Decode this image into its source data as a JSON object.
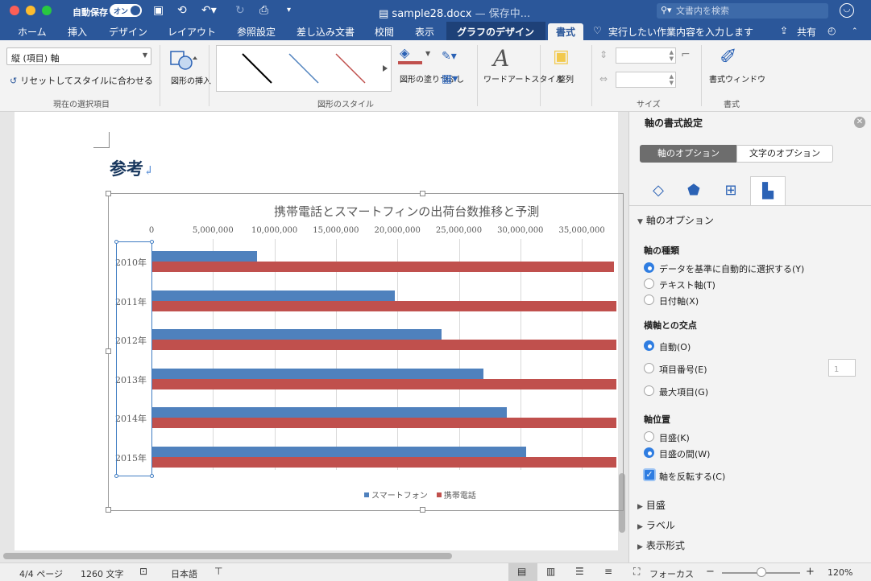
{
  "titlebar": {
    "autosave_label": "自動保存",
    "autosave_state": "オン",
    "file_name": "sample28.docx",
    "save_status": "— 保存中...",
    "search_placeholder": "文書内を検索"
  },
  "tabs": [
    "ホーム",
    "挿入",
    "デザイン",
    "レイアウト",
    "参照設定",
    "差し込み文書",
    "校閲",
    "表示",
    "グラフのデザイン",
    "書式"
  ],
  "active_tab": "書式",
  "tell_me": "実行したい作業内容を入力します",
  "share_label": "共有",
  "ribbon": {
    "selection_value": "縦 (項目) 軸",
    "reset_label": "リセットしてスタイルに合わせる",
    "group_current_selection": "現在の選択項目",
    "insert_shape": "図形の挿入",
    "group_shape_styles": "図形のスタイル",
    "shape_fill": "図形の塗りつぶし",
    "wordart": "ワードアートスタイル",
    "arrange": "整列",
    "group_size": "サイズ",
    "format_pane": "書式ウィンドウ",
    "group_format": "書式"
  },
  "document": {
    "heading": "参考",
    "chart": {
      "legend": [
        "スマートフォン",
        "携帯電話"
      ]
    }
  },
  "chart_data": {
    "type": "bar",
    "orientation": "horizontal",
    "title": "携帯電話とスマートフィンの出荷台数推移と予測",
    "categories": [
      "2010年",
      "2011年",
      "2012年",
      "2013年",
      "2014年",
      "2015年"
    ],
    "x_ticks": [
      "0",
      "5,000,000",
      "10,000,000",
      "15,000,000",
      "20,000,000",
      "25,000,000",
      "30,000,000",
      "35,000,000"
    ],
    "xlim": [
      0,
      40000000
    ],
    "y_reversed": true,
    "x_axis_position": "top",
    "grid": true,
    "legend_position": "bottom",
    "series": [
      {
        "name": "スマートフォン",
        "color": "#4f81bd",
        "values": [
          8600000,
          19800000,
          23600000,
          27000000,
          28900000,
          30500000
        ]
      },
      {
        "name": "携帯電話",
        "color": "#c0504d",
        "values": [
          37600000,
          40000000,
          40000000,
          40000000,
          40000000,
          40000000
        ]
      }
    ]
  },
  "pane": {
    "title": "軸の書式設定",
    "tab_axis": "軸のオプション",
    "tab_text": "文字のオプション",
    "section_axis_options": "軸のオプション",
    "axis_type_title": "軸の種類",
    "axis_type_options": [
      "データを基準に自動的に選択する(Y)",
      "テキスト軸(T)",
      "日付軸(X)"
    ],
    "cross_title": "横軸との交点",
    "cross_options": [
      "自動(O)",
      "項目番号(E)",
      "最大項目(G)"
    ],
    "cross_index_value": "1",
    "position_title": "軸位置",
    "position_options": [
      "目盛(K)",
      "目盛の間(W)"
    ],
    "reverse_label": "軸を反転する(C)",
    "collapsed_sections": [
      "目盛",
      "ラベル",
      "表示形式"
    ]
  },
  "statusbar": {
    "page": "4/4 ページ",
    "words": "1260 文字",
    "language": "日本語",
    "focus": "フォーカス",
    "zoom": "120%"
  }
}
